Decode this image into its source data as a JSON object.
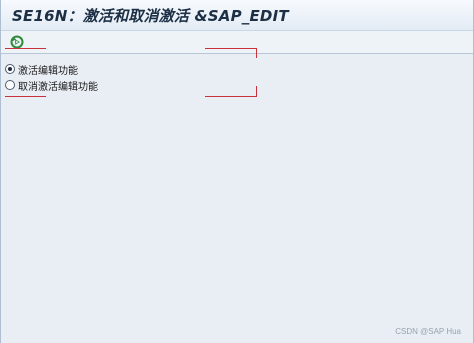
{
  "window": {
    "title": "SE16N：激活和取消激活 &SAP_EDIT"
  },
  "toolbar": {
    "execute_icon": "execute-icon",
    "execute_color": "#2f8a3c"
  },
  "options": [
    {
      "label": "激活编辑功能",
      "selected": true
    },
    {
      "label": "取消激活编辑功能",
      "selected": false
    }
  ],
  "annotation": {
    "color": "#c8323c"
  },
  "watermark": "CSDN @SAP Hua"
}
